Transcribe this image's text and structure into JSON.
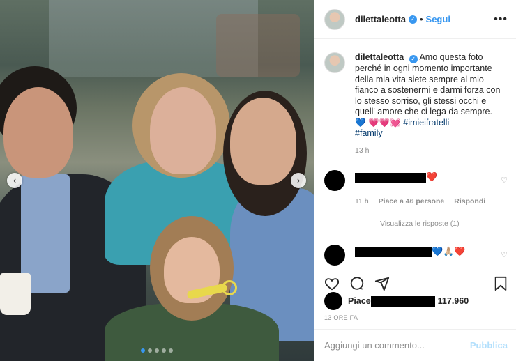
{
  "header": {
    "username": "dilettaleotta",
    "separator": "•",
    "follow_label": "Segui",
    "more_icon": "•••",
    "verified_icon": "✓"
  },
  "caption": {
    "username": "dilettaleotta",
    "text": "Amo questa foto perché in ogni momento importante della mia vita siete sempre al mio fianco a sostenermi e darmi forza con lo stesso sorriso, gli stessi occhi e quell' amore che ci lega da sempre.",
    "blue_heart": "💙",
    "pink_hearts": "💗💗💓",
    "hashtag_1": "#imieifratelli",
    "hashtag_2": "#family",
    "time": "13 h"
  },
  "comments": [
    {
      "emoji": "❤️",
      "time": "11 h",
      "likes": "Piace a 46 persone",
      "reply_label": "Rispondi",
      "view_replies": "Visualizza le risposte (1)"
    },
    {
      "emoji": "💙🙏🏼❤️"
    }
  ],
  "like_icon": "♡",
  "actions": {
    "like": "heart-outline-icon",
    "comment": "comment-bubble-icon",
    "share": "paper-plane-icon",
    "save": "bookmark-icon"
  },
  "likes": {
    "prefix": "Piace",
    "count": "117.960"
  },
  "posted_ago": "13 ORE FA",
  "add_comment": {
    "placeholder": "Aggiungi un commento...",
    "publish_label": "Pubblica"
  },
  "carousel": {
    "prev_arrow": "‹",
    "next_arrow": "›",
    "total_slides": 5,
    "active_slide": 1
  },
  "colors": {
    "accent": "#3897f0",
    "muted": "#8e8e8e",
    "text": "#262626",
    "publish_disabled": "#b2dffc",
    "hashtag": "#00376b"
  }
}
